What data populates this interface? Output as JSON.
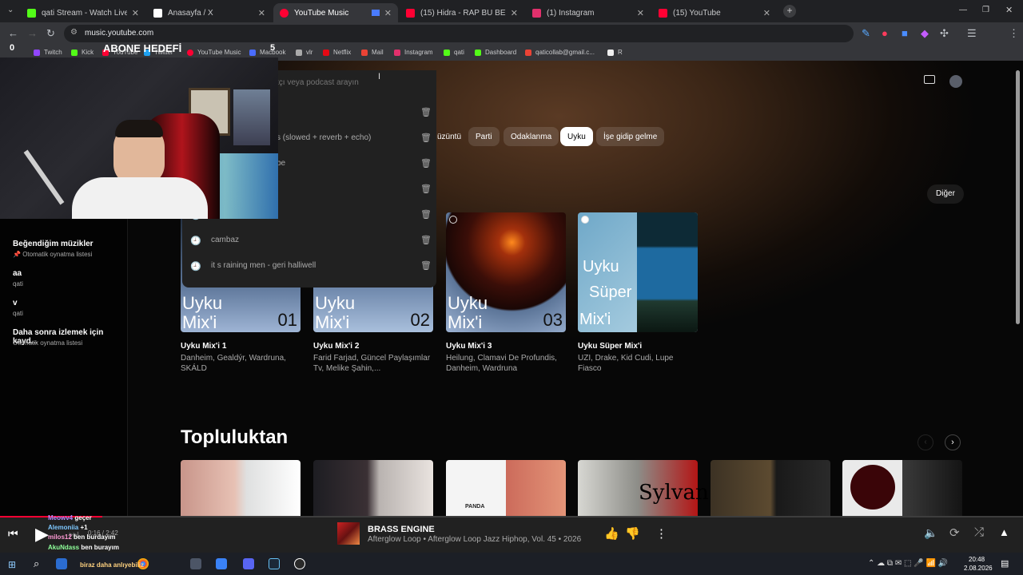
{
  "tabs": [
    {
      "label": "qati Stream - Watch Live on Ki",
      "color": "#53fc18"
    },
    {
      "label": "Anasayfa / X",
      "color": "#ffffff"
    },
    {
      "label": "YouTube Music",
      "color": "#ff0033"
    },
    {
      "label": "(15) Hidra - RAP BU BEYLER - Y",
      "color": "#ff0033"
    },
    {
      "label": "(1) Instagram",
      "color": "#e1306c"
    },
    {
      "label": "(15) YouTube",
      "color": "#ff0033"
    }
  ],
  "browser": {
    "url": "music.youtube.com"
  },
  "bookmarks": [
    "Twitch",
    "Kick",
    "YouTube",
    "Twitter",
    "YouTube Music",
    "Macbook",
    "vlr",
    "Netflix",
    "Mail",
    "Instagram",
    "qati",
    "Dashboard",
    "qaticollab@gmail.c...",
    "R"
  ],
  "overlay": {
    "left_count": "0",
    "goal_label": "ABONE HEDEFİ",
    "goal_count": "5"
  },
  "search": {
    "placeholder": "tçı veya podcast arayın",
    "recent": [
      "",
      "s (slowed + reverb + echo)",
      "be",
      "",
      "",
      "cambaz",
      "it s raining men - geri halliwell"
    ]
  },
  "chips": [
    "üzüntü",
    "Parti",
    "Odaklanma",
    "Uyku",
    "İşe gidip gelme"
  ],
  "more_button": "Diğer",
  "sidebar": {
    "playlists": [
      {
        "title": "Beğendiğim müzikler",
        "sub": "Otomatik oynatma listesi"
      },
      {
        "title": "aa",
        "sub": "qati"
      },
      {
        "title": "v",
        "sub": "qati"
      },
      {
        "title": "Daha sonra izlemek için kayd...",
        "sub": "Otomatik oynatma listesi"
      }
    ]
  },
  "mixes": [
    {
      "line1": "Uyku",
      "line2": "Mix'i",
      "num": "01",
      "title": "Uyku Mix'i 1",
      "sub": "Danheim, Gealdýr, Wardruna, SKÁLD"
    },
    {
      "line1": "Uyku",
      "line2": "Mix'i",
      "num": "02",
      "title": "Uyku Mix'i 2",
      "sub": "Farid Farjad, Güncel Paylaşımlar Tv, Melike Şahin,..."
    },
    {
      "line1": "Uyku",
      "line2": "Mix'i",
      "num": "03",
      "title": "Uyku Mix'i 3",
      "sub": "Heilung, Clamavi De Profundis, Danheim, Wardruna"
    },
    {
      "line1": "Uyku",
      "line2": "Süper",
      "line3": "Mix'i",
      "title": "Uyku Süper Mix'i",
      "sub": "UZI, Drake, Kid Cudi, Lupe Fiasco"
    }
  ],
  "community": {
    "heading": "Topluluktan",
    "panda_text": "PANDA",
    "sylvan_text": "Sylvan"
  },
  "player": {
    "time": "0:16 / 2:42",
    "title": "BRASS ENGINE",
    "subtitle": "Afterglow Loop • Afterglow Loop Jazz Hiphop, Vol. 45 • 2026"
  },
  "chat": [
    {
      "user": "Meowv4",
      "msg": "geçer",
      "color": "#b48cff"
    },
    {
      "user": "Alemoniia",
      "msg": "+1",
      "color": "#7ec8ff"
    },
    {
      "user": "milos12",
      "msg": "ben burdayım",
      "color": "#ff9ad5"
    },
    {
      "user": "AkuNdass",
      "msg": "ben burayım",
      "color": "#8fff9a"
    },
    {
      "user": "",
      "msg": "biraz daha anlıyebiliz",
      "color": "#ffd27f"
    }
  ],
  "clock": {
    "time": "20:48",
    "date": "2.08.2026"
  }
}
